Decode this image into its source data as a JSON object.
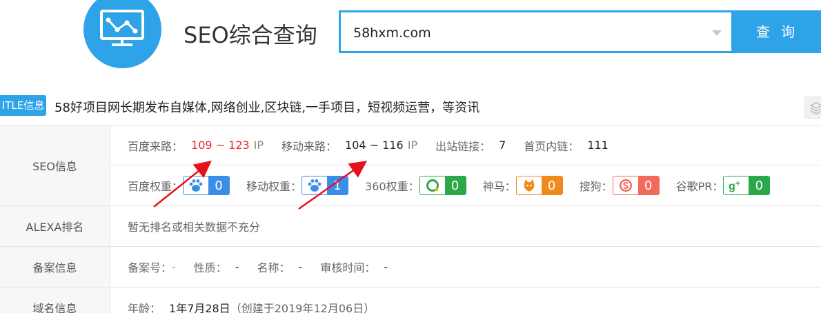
{
  "brand": {
    "title": "SEO综合查询"
  },
  "search": {
    "value": "58hxm.com",
    "button": "查 询"
  },
  "title_info": {
    "badge": "ITLE信息",
    "text": "58好项目网长期发布自媒体,网络创业,区块链,一手项目，短视频运营，等资讯"
  },
  "seo": {
    "label": "SEO信息",
    "baidu_traffic_label": "百度来路：",
    "baidu_traffic_value": "109 ~ 123",
    "ip_unit": "IP",
    "mobile_traffic_label": "移动来路：",
    "mobile_traffic_value": "104 ~ 116",
    "outbound_label": "出站链接：",
    "outbound_value": "7",
    "inner_label": "首页内链：",
    "inner_value": "111",
    "weights": [
      {
        "label": "百度权重：",
        "value": "0",
        "color": "#3a8ee6",
        "icon": "paw-icon"
      },
      {
        "label": "移动权重：",
        "value": "1",
        "color": "#3a8ee6",
        "icon": "paw-icon"
      },
      {
        "label": "360权重：",
        "value": "0",
        "color": "#2aa84a",
        "icon": "360-icon"
      },
      {
        "label": "神马：",
        "value": "0",
        "color": "#f08a1c",
        "icon": "shenma-icon"
      },
      {
        "label": "搜狗：",
        "value": "0",
        "color": "#f16a5a",
        "icon": "sogou-icon"
      },
      {
        "label": "谷歌PR：",
        "value": "0",
        "color": "#2aa84a",
        "icon": "google-plus-icon"
      }
    ]
  },
  "alexa": {
    "label": "ALEXA排名",
    "value": "暂无排名或相关数据不充分"
  },
  "icp": {
    "label": "备案信息",
    "number_label": "备案号：",
    "number_value": "-",
    "nature_label": "性质：",
    "nature_value": "-",
    "name_label": "名称：",
    "name_value": "-",
    "time_label": "审核时间：",
    "time_value": "-"
  },
  "domain": {
    "label": "域名信息",
    "age_label": "年龄：",
    "age_value": "1年7月28日",
    "created": "（创建于2019年12月06日）"
  }
}
